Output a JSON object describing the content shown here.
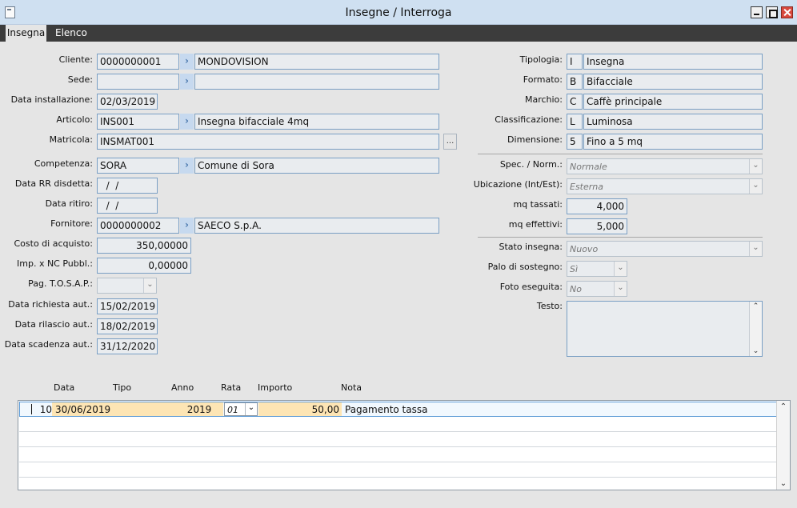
{
  "window": {
    "title": "Insegne / Interroga"
  },
  "tabs": {
    "active": "Insegna",
    "other": "Elenco"
  },
  "left": {
    "cliente": {
      "label": "Cliente:",
      "code": "0000000001",
      "desc": "MONDOVISION"
    },
    "sede": {
      "label": "Sede:",
      "code": "",
      "desc": ""
    },
    "data_installazione": {
      "label": "Data installazione:",
      "value": "02/03/2019"
    },
    "articolo": {
      "label": "Articolo:",
      "code": "INS001",
      "desc": "Insegna bifacciale 4mq"
    },
    "matricola": {
      "label": "Matricola:",
      "value": "INSMAT001",
      "button": "..."
    },
    "competenza": {
      "label": "Competenza:",
      "code": "SORA",
      "desc": "Comune di Sora"
    },
    "data_rr_disdetta": {
      "label": "Data RR disdetta:",
      "value": "  /  /"
    },
    "data_ritiro": {
      "label": "Data ritiro:",
      "value": "  /  /"
    },
    "fornitore": {
      "label": "Fornitore:",
      "code": "0000000002",
      "desc": "SAECO S.p.A."
    },
    "costo_acquisto": {
      "label": "Costo di acquisto:",
      "value": "350,00000"
    },
    "imp_nc_pubbl": {
      "label": "Imp. x NC Pubbl.:",
      "value": "0,00000"
    },
    "pag_tosap": {
      "label": "Pag. T.O.S.A.P.:",
      "value": ""
    },
    "data_richiesta_aut": {
      "label": "Data richiesta aut.:",
      "value": "15/02/2019"
    },
    "data_rilascio_aut": {
      "label": "Data rilascio aut.:",
      "value": "18/02/2019"
    },
    "data_scadenza_aut": {
      "label": "Data scadenza aut.:",
      "value": "31/12/2020"
    }
  },
  "right": {
    "tipologia": {
      "label": "Tipologia:",
      "code": "I",
      "desc": "Insegna"
    },
    "formato": {
      "label": "Formato:",
      "code": "B",
      "desc": "Bifacciale"
    },
    "marchio": {
      "label": "Marchio:",
      "code": "C",
      "desc": "Caffè principale"
    },
    "classificazione": {
      "label": "Classificazione:",
      "code": "L",
      "desc": "Luminosa"
    },
    "dimensione": {
      "label": "Dimensione:",
      "code": "5",
      "desc": "Fino a 5 mq"
    },
    "spec_norm": {
      "label": "Spec. / Norm.:",
      "value": "Normale"
    },
    "ubicazione": {
      "label": "Ubicazione (Int/Est):",
      "value": "Esterna"
    },
    "mq_tassati": {
      "label": "mq tassati:",
      "value": "4,000"
    },
    "mq_effettivi": {
      "label": "mq effettivi:",
      "value": "5,000"
    },
    "stato_insegna": {
      "label": "Stato insegna:",
      "value": "Nuovo"
    },
    "palo_sostegno": {
      "label": "Palo di sostegno:",
      "value": "Sì"
    },
    "foto_eseguita": {
      "label": "Foto eseguita:",
      "value": "No"
    },
    "testo": {
      "label": "Testo:",
      "value": ""
    }
  },
  "grid": {
    "headers": {
      "data": "Data",
      "tipo": "Tipo",
      "anno": "Anno",
      "rata": "Rata",
      "importo": "Importo",
      "nota": "Nota"
    },
    "rows": [
      {
        "num": "10",
        "data": "30/06/2019",
        "anno": "2019",
        "rata": "01",
        "importo": "50,00",
        "nota": "Pagamento tassa"
      }
    ]
  },
  "icons": {
    "zoom": "chevron-right-icon",
    "dropdown": "chevron-down-icon"
  },
  "colors": {
    "title_bar": "#cfe0f1",
    "tab_bar": "#3c3c3c",
    "field_border": "#7a9fc4",
    "row_highlight": "#fde5b4",
    "close_button": "#d8483d"
  }
}
